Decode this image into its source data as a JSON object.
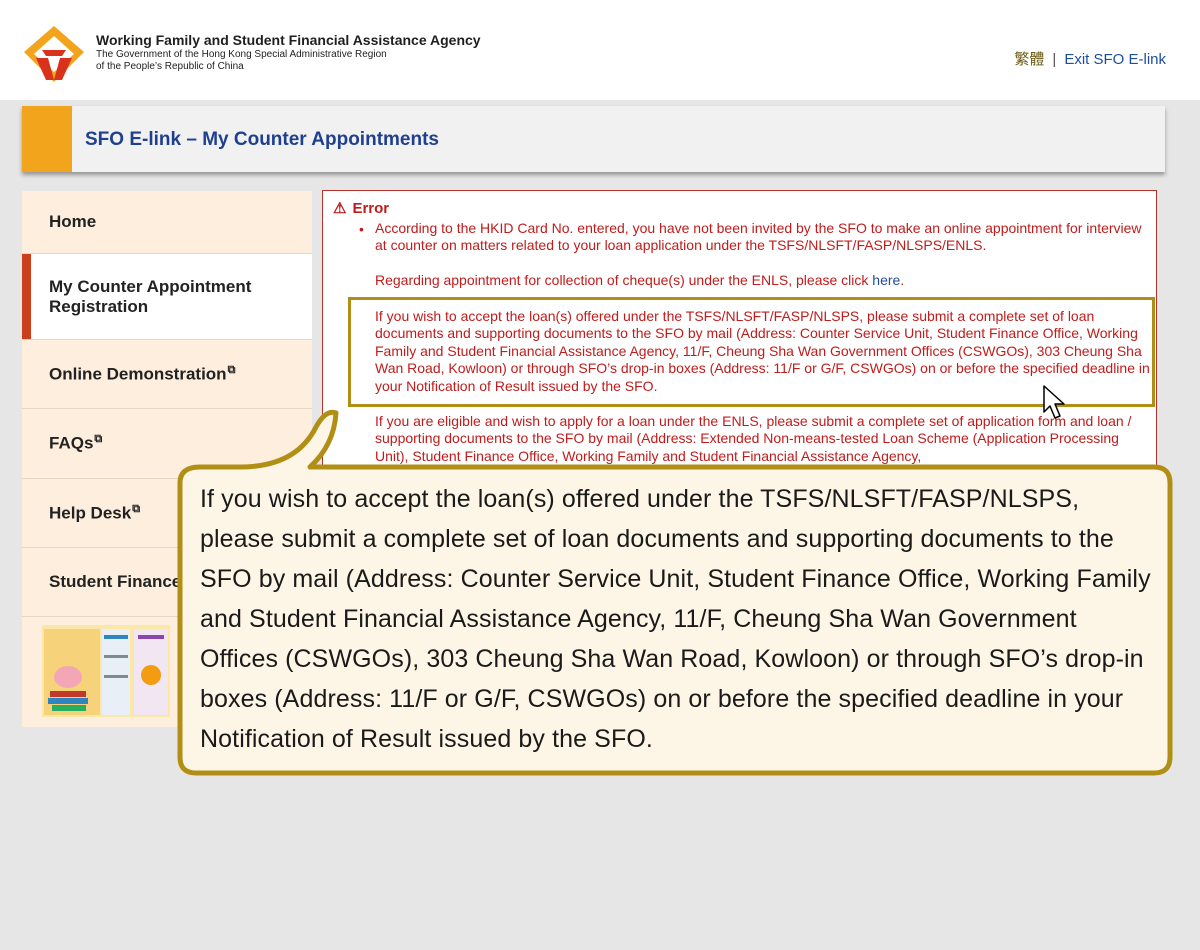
{
  "header": {
    "agency_name": "Working Family and Student Financial Assistance Agency",
    "agency_sub_line1": "The Government of the Hong Kong Special Administrative Region",
    "agency_sub_line2": "of the People’s Republic of China",
    "lang_link": "繁體",
    "separator": "|",
    "exit_link": "Exit SFO E-link"
  },
  "title_bar": {
    "title": "SFO E-link – My Counter Appointments"
  },
  "sidebar": {
    "items": [
      {
        "label": "Home",
        "external": false,
        "active": false
      },
      {
        "label": "My Counter Appointment Registration",
        "external": false,
        "active": true
      },
      {
        "label": "Online Demonstration",
        "external": true,
        "active": false
      },
      {
        "label": "FAQs",
        "external": true,
        "active": false
      },
      {
        "label": "Help Desk",
        "external": true,
        "active": false
      },
      {
        "label": "Student Finance",
        "external": false,
        "active": false
      }
    ],
    "external_icon": "external-link-icon"
  },
  "error": {
    "title": "Error",
    "icon": "warning-icon",
    "para1": "According to the HKID Card No. entered, you have not been invited by the SFO to make an online appointment for interview at counter on matters related to your loan application under the TSFS/NLSFT/FASP/NLSPS/ENLS.",
    "para2_prefix": "Regarding appointment for collection of cheque(s) under the ENLS, please click",
    "para2_link": "here",
    "para2_suffix": ".",
    "para3": "If you wish to accept the loan(s) offered under the TSFS/NLSFT/FASP/NLSPS, please submit a complete set of loan documents and supporting documents to the SFO by mail (Address: Counter Service Unit, Student Finance Office, Working Family and Student Financial Assistance Agency, 11/F, Cheung Sha Wan Government Offices (CSWGOs), 303 Cheung Sha Wan Road, Kowloon) or through SFO’s drop-in boxes (Address: 11/F or G/F, CSWGOs) on or before the specified deadline in your Notification of Result issued by the SFO.",
    "para4": "If you are eligible and wish to apply for a loan under the ENLS, please submit a complete set of application form and loan / supporting documents to the SFO by mail (Address: Extended Non-means-tested Loan Scheme (Application Processing Unit), Student Finance Office, Working Family and Student Financial Assistance Agency,"
  },
  "callout": {
    "text": "If you wish to accept the loan(s) offered under the TSFS/NLSFT/FASP/NLSPS, please submit a complete set of loan documents and supporting documents to the SFO by mail (Address: Counter Service Unit, Student Finance Office, Working Family and Student Financial Assistance Agency, 11/F, Cheung Sha Wan Government Offices (CSWGOs), 303 Cheung Sha Wan Road, Kowloon) or through SFO’s drop-in boxes (Address: 11/F or G/F, CSWGOs) on or before the specified deadline in your Notification of Result issued by the SFO."
  },
  "colors": {
    "brand_orange": "#f2a51c",
    "brand_red": "#d8321c",
    "title_blue": "#1f3f8f",
    "error_red": "#c11b1b",
    "highlight_gold": "#b18f16",
    "callout_bg": "#fdf6e6"
  }
}
